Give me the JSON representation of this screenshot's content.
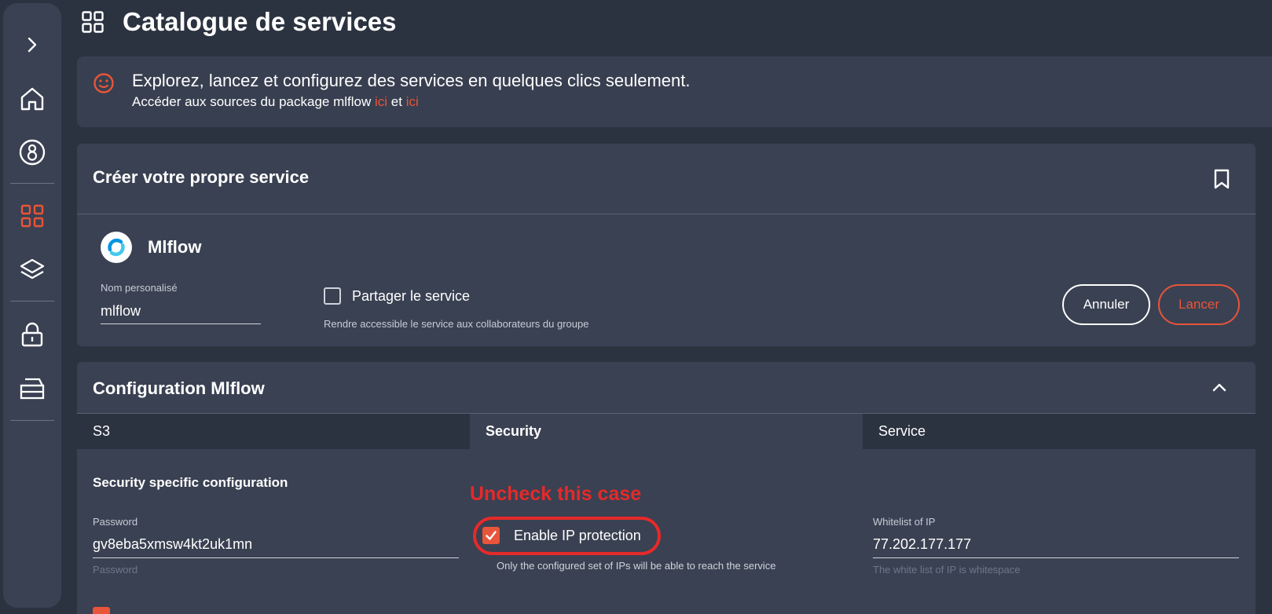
{
  "page": {
    "title": "Catalogue de services"
  },
  "sidebar": {
    "items": [
      {
        "name": "expand",
        "icon": "chevron-right-icon"
      },
      {
        "name": "home",
        "icon": "home-icon"
      },
      {
        "name": "account",
        "icon": "account-icon"
      },
      {
        "name": "catalog",
        "icon": "grid-icon",
        "active": true
      },
      {
        "name": "my-services",
        "icon": "layers-icon"
      },
      {
        "name": "secrets",
        "icon": "lock-icon"
      },
      {
        "name": "file-explorer",
        "icon": "tray-icon"
      }
    ],
    "active_color": "#e8553a"
  },
  "banner": {
    "heading": "Explorez, lancez et configurez des services en quelques clics seulement.",
    "text_prefix": "Accéder aux sources du package mlflow ",
    "link1": "ici",
    "text_mid": " et ",
    "link2": "ici"
  },
  "create_card": {
    "title": "Créer votre propre service",
    "service_name": "Mlflow",
    "custom_name_label": "Nom personalisé",
    "custom_name_value": "mlflow",
    "share_label": "Partager le service",
    "share_checked": false,
    "share_help": "Rendre accessible le service aux collaborateurs du groupe",
    "cancel_label": "Annuler",
    "launch_label": "Lancer"
  },
  "config_card": {
    "title": "Configuration Mlflow",
    "tabs": [
      {
        "label": "S3",
        "active": false
      },
      {
        "label": "Security",
        "active": true
      },
      {
        "label": "Service",
        "active": false
      }
    ],
    "section_title": "Security specific configuration",
    "password": {
      "label": "Password",
      "value": "gv8eba5xmsw4kt2uk1mn",
      "help": "Password"
    },
    "ip_protection": {
      "label": "Enable IP protection",
      "checked": true,
      "help": "Only the configured set of IPs will be able to reach the service"
    },
    "whitelist": {
      "label": "Whitelist of IP",
      "value": "77.202.177.177",
      "help": "The white list of IP is whitespace"
    }
  },
  "annotation": {
    "text": "Uncheck this case",
    "color": "#e52a2a"
  },
  "colors": {
    "background": "#2c3340",
    "panel": "#3a4152",
    "accent": "#e8553a"
  }
}
